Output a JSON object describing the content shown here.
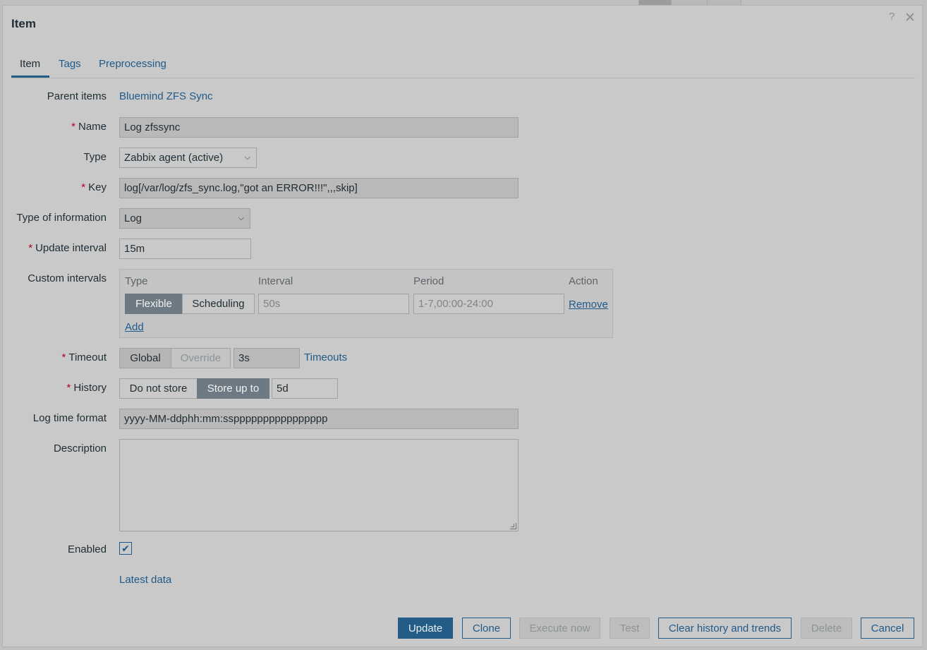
{
  "dialog": {
    "title": "Item"
  },
  "header_icons": {
    "help": "?",
    "close": "✕"
  },
  "tabs": [
    {
      "label": "Item"
    },
    {
      "label": "Tags"
    },
    {
      "label": "Preprocessing"
    }
  ],
  "form": {
    "parent_items": {
      "label": "Parent items",
      "value": "Bluemind ZFS Sync"
    },
    "name": {
      "label": "Name",
      "value": "Log zfssync"
    },
    "type": {
      "label": "Type",
      "value": "Zabbix agent (active)"
    },
    "key": {
      "label": "Key",
      "value": "log[/var/log/zfs_sync.log,\"got an ERROR!!!\",,,skip]"
    },
    "type_of_information": {
      "label": "Type of information",
      "value": "Log"
    },
    "update_interval": {
      "label": "Update interval",
      "value": "15m"
    },
    "custom_intervals": {
      "label": "Custom intervals",
      "headers": {
        "type": "Type",
        "interval": "Interval",
        "period": "Period",
        "action": "Action"
      },
      "row": {
        "flexible": "Flexible",
        "scheduling": "Scheduling",
        "interval_placeholder": "50s",
        "period_placeholder": "1-7,00:00-24:00",
        "remove": "Remove"
      },
      "add": "Add"
    },
    "timeout": {
      "label": "Timeout",
      "global": "Global",
      "override": "Override",
      "value": "3s",
      "link": "Timeouts"
    },
    "history": {
      "label": "History",
      "do_not_store": "Do not store",
      "store_up_to": "Store up to",
      "value": "5d"
    },
    "log_time_format": {
      "label": "Log time format",
      "value": "yyyy-MM-ddphh:mm:sspppppppppppppppp"
    },
    "description": {
      "label": "Description",
      "value": ""
    },
    "enabled": {
      "label": "Enabled",
      "checked": true,
      "mark": "✔"
    },
    "latest_data": "Latest data"
  },
  "buttons": {
    "update": "Update",
    "clone": "Clone",
    "execute_now": "Execute now",
    "test": "Test",
    "clear_history": "Clear history and trends",
    "delete": "Delete",
    "cancel": "Cancel"
  },
  "colors": {
    "primary": "#245c88",
    "link": "#1f5a8b",
    "required": "#b0001f"
  }
}
